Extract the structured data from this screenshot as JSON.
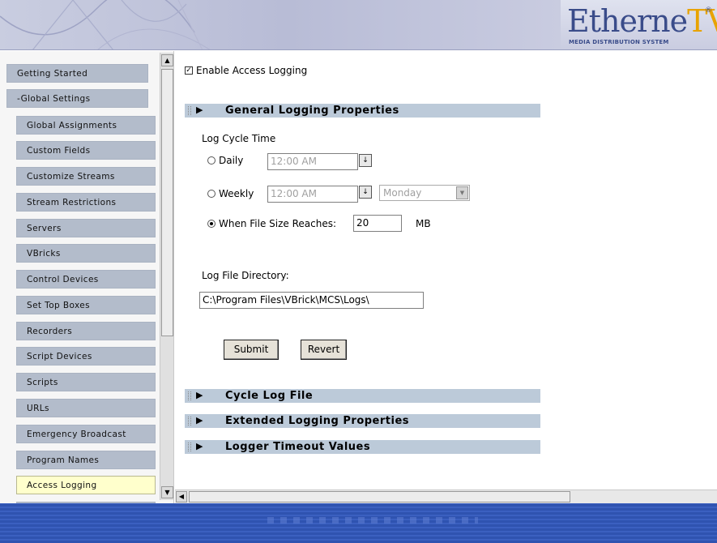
{
  "brand": {
    "name_main": "Etherne",
    "name_accent": "TV",
    "registered": "®",
    "tagline": "MEDIA DISTRIBUTION SYSTEM",
    "colors": {
      "logo": "#3a4c8a",
      "accent": "#e8a300"
    }
  },
  "sidebar": {
    "items": [
      {
        "label": "Getting Started",
        "level": "top",
        "active": false
      },
      {
        "label": "-Global Settings",
        "level": "top",
        "active": false
      },
      {
        "label": "Global Assignments",
        "level": "sub",
        "active": false
      },
      {
        "label": "Custom Fields",
        "level": "sub",
        "active": false
      },
      {
        "label": "Customize Streams",
        "level": "sub",
        "active": false
      },
      {
        "label": "Stream Restrictions",
        "level": "sub",
        "active": false
      },
      {
        "label": "Servers",
        "level": "sub",
        "active": false
      },
      {
        "label": "VBricks",
        "level": "sub",
        "active": false
      },
      {
        "label": "Control Devices",
        "level": "sub",
        "active": false
      },
      {
        "label": "Set Top Boxes",
        "level": "sub",
        "active": false
      },
      {
        "label": "Recorders",
        "level": "sub",
        "active": false
      },
      {
        "label": "Script Devices",
        "level": "sub",
        "active": false
      },
      {
        "label": "Scripts",
        "level": "sub",
        "active": false
      },
      {
        "label": "URLs",
        "level": "sub",
        "active": false
      },
      {
        "label": "Emergency Broadcast",
        "level": "sub",
        "active": false
      },
      {
        "label": "Program Names",
        "level": "sub",
        "active": false
      },
      {
        "label": "Access Logging",
        "level": "sub",
        "active": true
      }
    ],
    "colors": {
      "item": "#b3bccb",
      "active": "#ffffcc"
    }
  },
  "main": {
    "enable_label": "Enable Access Logging",
    "enable_checked": true,
    "sections": {
      "general": "General Logging Properties",
      "cycle": "Cycle Log File",
      "extended": "Extended Logging Properties",
      "timeout": "Logger Timeout Values"
    },
    "log_cycle_time_label": "Log Cycle Time",
    "daily": {
      "label": "Daily",
      "time": "12:00 AM",
      "selected": false
    },
    "weekly": {
      "label": "Weekly",
      "time": "12:00 AM",
      "day": "Monday",
      "selected": false
    },
    "file_size": {
      "label": "When File Size Reaches:",
      "value": "20",
      "unit": "MB",
      "selected": true
    },
    "log_dir_label": "Log File Directory:",
    "log_dir_value": "C:\\Program Files\\VBrick\\MCS\\Logs\\",
    "submit_label": "Submit",
    "revert_label": "Revert"
  },
  "icons": {
    "collapse": "▶",
    "scroll_up": "▲",
    "scroll_down": "▼",
    "scroll_left": "◀",
    "dropdown": "↓",
    "check": "✓"
  }
}
